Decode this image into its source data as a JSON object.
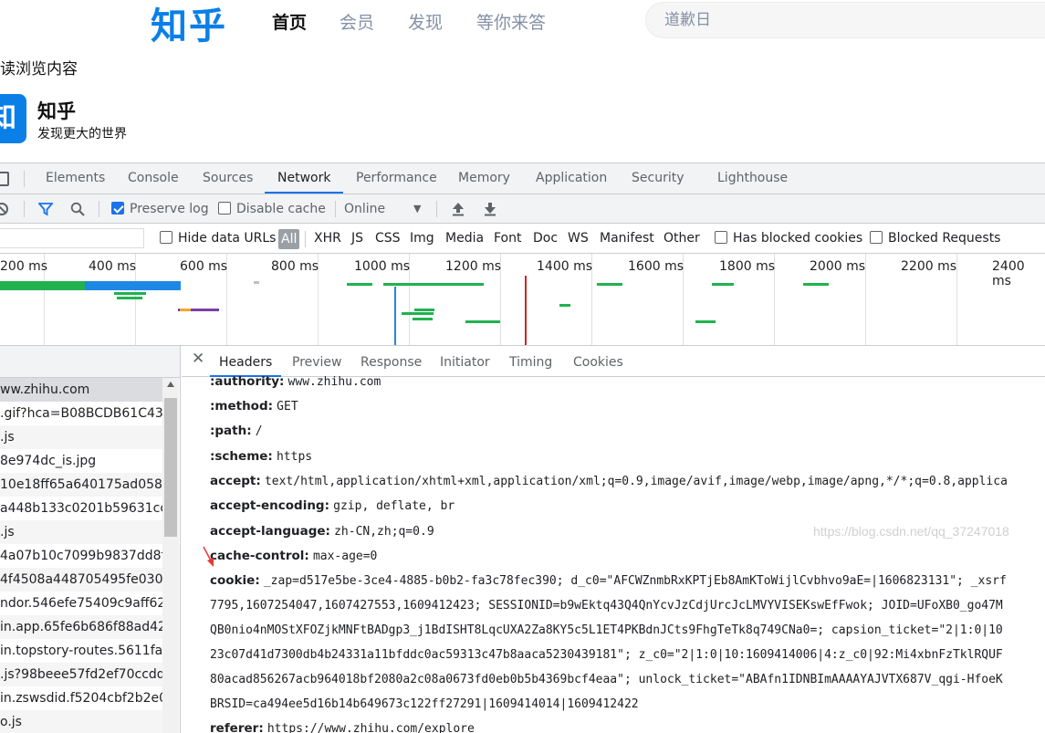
{
  "zhihu": {
    "logo": "知乎",
    "nav": [
      "首页",
      "会员",
      "发现",
      "等你来答"
    ],
    "search_placeholder": "道歉日",
    "continue_text": "读浏览内容",
    "app_logo_char": "知",
    "app_name": "知乎",
    "app_slogan": "发现更大的世界"
  },
  "devtools": {
    "tabs": [
      "Elements",
      "Console",
      "Sources",
      "Network",
      "Performance",
      "Memory",
      "Application",
      "Security",
      "Lighthouse"
    ],
    "active_tab": "Network",
    "toolbar": {
      "preserve_log": "Preserve log",
      "disable_cache": "Disable cache",
      "throttling": "Online"
    },
    "filter": {
      "hide_data_urls": "Hide data URLs",
      "types": [
        "All",
        "XHR",
        "JS",
        "CSS",
        "Img",
        "Media",
        "Font",
        "Doc",
        "WS",
        "Manifest",
        "Other"
      ],
      "has_blocked_cookies": "Has blocked cookies",
      "blocked_requests": "Blocked Requests"
    },
    "overview_ticks": [
      "200 ms",
      "400 ms",
      "600 ms",
      "800 ms",
      "1000 ms",
      "1200 ms",
      "1400 ms",
      "1600 ms",
      "1800 ms",
      "2000 ms",
      "2200 ms",
      "2400 ms"
    ],
    "requests": [
      "ww.zhihu.com",
      ".gif?hca=B08BCDB61C438.",
      ".js",
      "8e974dc_is.jpg",
      "10e18ff65a640175ad058b4",
      "a448b133c0201b59631ccfa",
      ".js",
      "4a07b10c7099b9837dd8fb",
      "4f4508a448705495fe03026",
      "ndor.546efe75409c9aff627c",
      "in.app.65fe6b686f88ad42c.",
      "in.topstory-routes.5611fa8.",
      ".js?98beee57fd2ef70ccdd5",
      "in.zswsdid.f5204cbf2b2e0c",
      "o.js"
    ],
    "detail_tabs": [
      "Headers",
      "Preview",
      "Response",
      "Initiator",
      "Timing",
      "Cookies"
    ],
    "active_detail_tab": "Headers",
    "headers": [
      {
        "name": ":authority:",
        "value": "www.zhihu.com"
      },
      {
        "name": ":method:",
        "value": "GET"
      },
      {
        "name": ":path:",
        "value": "/"
      },
      {
        "name": ":scheme:",
        "value": "https"
      },
      {
        "name": "accept:",
        "value": "text/html,application/xhtml+xml,application/xml;q=0.9,image/avif,image/webp,image/apng,*/*;q=0.8,applica"
      },
      {
        "name": "accept-encoding:",
        "value": "gzip, deflate, br"
      },
      {
        "name": "accept-language:",
        "value": "zh-CN,zh;q=0.9"
      },
      {
        "name": "cache-control:",
        "value": "max-age=0"
      },
      {
        "name": "cookie:",
        "value": "_zap=d517e5be-3ce4-4885-b0b2-fa3c78fec390; d_c0=\"AFCWZnmbRxKPTjEb8AmKToWijlCvbhvo9aE=|1606823131\"; _xsrf"
      },
      {
        "name": "",
        "value": "7795,1607254047,1607427553,1609412423; SESSIONID=b9wEktq43Q4QnYcvJzCdjUrcJcLMVYVISEKswEfFwok; JOID=UFoXB0_go47M"
      },
      {
        "name": "",
        "value": "QB0nio4nMOStXFOZjkMNFtBADgp3_j1BdISHT8LqcUXA2Za8KY5c5L1ET4PKBdnJCts9FhgTeTk8q749CNa0=; capsion_ticket=\"2|1:0|10"
      },
      {
        "name": "",
        "value": "23c07d41d7300db4b24331a11bfddc0ac59313c47b8aaca5230439181\"; z_c0=\"2|1:0|10:1609414006|4:z_c0|92:Mi4xbnFzTklRQUF"
      },
      {
        "name": "",
        "value": "80acad856267acb964018bf2080a2c08a0673fd0eb0b5b4369bcf4eaa\"; unlock_ticket=\"ABAfn1IDNBImAAAAYAJVTX687V_qgi-HfoeK"
      },
      {
        "name": "",
        "value": "BRSID=ca494ee5d16b14b649673c122ff27291|1609414014|1609412422"
      },
      {
        "name": "referer:",
        "value": "https://www.zhihu.com/explore"
      }
    ]
  },
  "watermark": "https://blog.csdn.net/qq_37247018",
  "colors": {
    "accent": "#1a73e8",
    "zhihu_blue": "#0a7fe8",
    "annotation_arrow": "#e53935"
  }
}
